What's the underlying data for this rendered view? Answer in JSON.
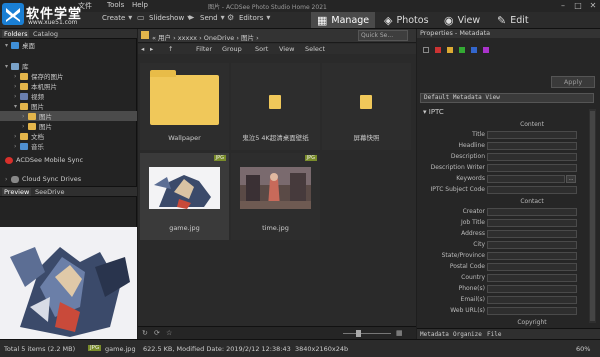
{
  "app": {
    "title": "图片 - ACDSee Photo Studio Home 2021",
    "menu": [
      "文件",
      "Tools",
      "Help"
    ],
    "logo_text": "软件学堂",
    "logo_url": "www.xue51.com"
  },
  "toolbar": {
    "create": "Create",
    "slideshow": "Slideshow",
    "send": "Send",
    "editors": "Editors",
    "modes": [
      {
        "label": "Manage",
        "icon": "grid-icon"
      },
      {
        "label": "Photos",
        "icon": "photos-icon"
      },
      {
        "label": "View",
        "icon": "eye-icon"
      },
      {
        "label": "Edit",
        "icon": "edit-icon"
      }
    ]
  },
  "left": {
    "tabs": [
      "Folders",
      "Catalog"
    ],
    "tree": [
      {
        "label": "桌面",
        "level": 0
      },
      {
        "label": "库",
        "level": 0
      },
      {
        "label": "保存的图片",
        "level": 1
      },
      {
        "label": "本机照片",
        "level": 1
      },
      {
        "label": "视频",
        "level": 1
      },
      {
        "label": "图片",
        "level": 1
      },
      {
        "label": "图片",
        "level": 2
      },
      {
        "label": "图片",
        "level": 2
      },
      {
        "label": "文档",
        "level": 1
      },
      {
        "label": "音乐",
        "level": 1
      }
    ],
    "mobile_sync": "ACDSee Mobile Sync",
    "cloud_sync": "Cloud Sync Drives",
    "preview_tabs": [
      "Preview",
      "SeeDrive"
    ]
  },
  "center": {
    "crumbs": "« 用户 › xxxxx › OneDrive › 图片 ›",
    "search_placeholder": "Quick Se...",
    "viewbar": [
      "Filter",
      "Group",
      "Sort",
      "View",
      "Select"
    ],
    "items": [
      {
        "caption": "Wallpaper",
        "kind": "folder"
      },
      {
        "caption": "鬼泣5 4K超清桌面壁纸",
        "kind": "folder-small"
      },
      {
        "caption": "屏幕快照",
        "kind": "folder-small"
      },
      {
        "caption": "game.jpg",
        "kind": "image",
        "badge": "JPG"
      },
      {
        "caption": "time.jpg",
        "kind": "image",
        "badge": "JPG"
      }
    ]
  },
  "right": {
    "title": "Properties - Metadata",
    "apply": "Apply",
    "metadata_view": "Default Metadata View",
    "section": "IPTC",
    "groups": [
      {
        "title": "Content",
        "fields": [
          "Title",
          "Headline",
          "Description",
          "Description Writer",
          "Keywords",
          "IPTC Subject Code"
        ]
      },
      {
        "title": "Contact",
        "fields": [
          "Creator",
          "Job Title",
          "Address",
          "City",
          "State/Province",
          "Postal Code",
          "Country",
          "Phone(s)",
          "Email(s)",
          "Web URL(s)"
        ]
      },
      {
        "title": "Copyright",
        "fields": []
      }
    ],
    "tabs": [
      "Metadata",
      "Organize",
      "File"
    ]
  },
  "status": {
    "total": "Total 5 items  (2.2 MB)",
    "badge": "JPG",
    "file": "game.jpg",
    "details": "622.5 KB, Modified Date: 2019/2/12 12:38:43",
    "dims": "3840x2160x24b",
    "zoom": "60%"
  }
}
